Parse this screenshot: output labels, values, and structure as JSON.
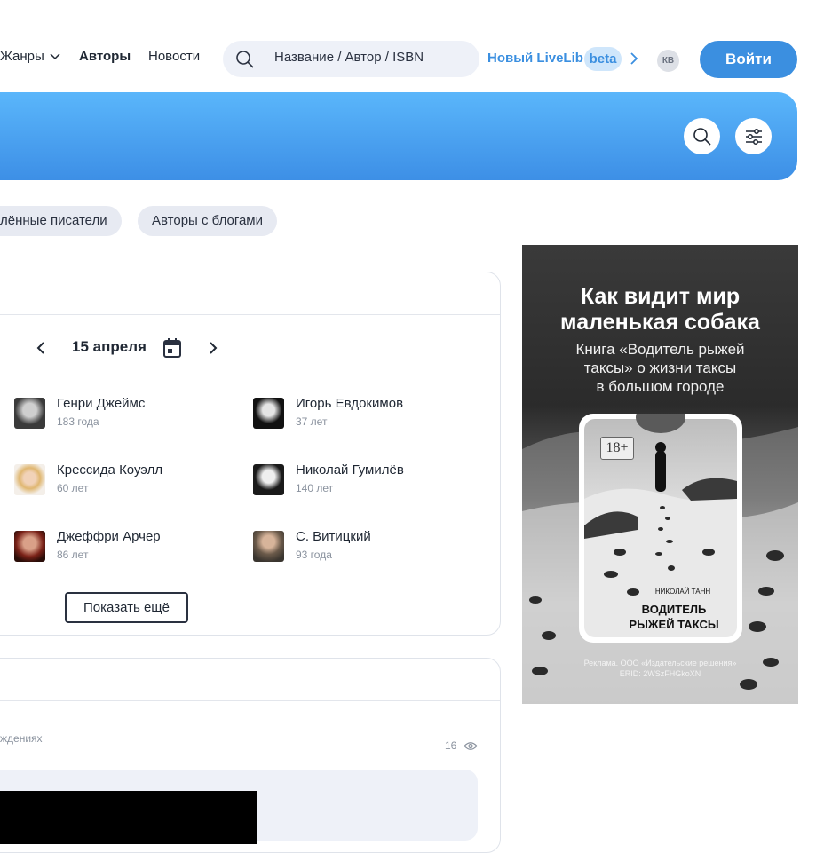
{
  "header": {
    "nav": [
      {
        "label": "Жанры",
        "has_dropdown": true
      },
      {
        "label": "Авторы",
        "active": true
      },
      {
        "label": "Новости"
      }
    ],
    "search_placeholder": "Название / Автор / ISBN",
    "new_livelib": "Новый LiveLib",
    "beta": "beta",
    "lang": "КВ",
    "login": "Войти"
  },
  "banner": {
    "search_icon": "search-icon",
    "filter_icon": "filter-icon"
  },
  "chips": [
    "лённые писатели",
    "Авторы с блогами"
  ],
  "birthdays": {
    "date": "15 апреля",
    "authors": [
      {
        "name": "Генри Джеймс",
        "age": "183 года"
      },
      {
        "name": "Игорь Евдокимов",
        "age": "37 лет"
      },
      {
        "name": "Крессида Коуэлл",
        "age": "60 лет"
      },
      {
        "name": "Николай Гумилёв",
        "age": "140 лет"
      },
      {
        "name": "Джеффри Арчер",
        "age": "86 лет"
      },
      {
        "name": "С. Витицкий",
        "age": "93 года"
      }
    ],
    "show_more": "Показать ещё"
  },
  "news": {
    "category": "ждениях",
    "views": "16"
  },
  "ad": {
    "title_line1": "Как видит мир",
    "title_line2": "маленькая собака",
    "subtitle_line1": "Книга «Водитель рыжей",
    "subtitle_line2": "таксы» о жизни таксы",
    "subtitle_line3": "в большом городе",
    "age_rating": "18+",
    "book_author": "НИКОЛАЙ ТАНН",
    "book_title_line1": "ВОДИТЕЛЬ",
    "book_title_line2": "РЫЖЕЙ ТАКСЫ",
    "legal_line1": "Реклама. ООО «Издательские решения»",
    "legal_line2": "ERID: 2WSzFHGkoXN"
  }
}
